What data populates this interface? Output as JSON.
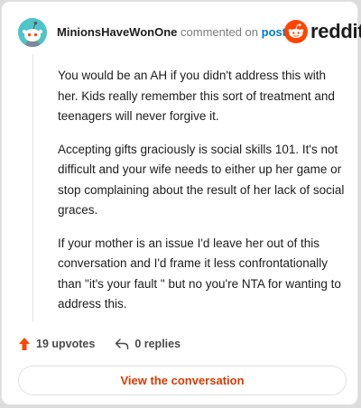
{
  "header": {
    "username": "MinionsHaveWonOne",
    "action_text": "commented on",
    "post_link": "post",
    "brand": "reddit"
  },
  "comment": {
    "paragraphs": [
      "You would be an AH if you didn't address this with her. Kids really remember this sort of treatment and teenagers will never forgive it.",
      "Accepting gifts graciously is social skills 101. It's not difficult and your wife needs to either up her game or stop complaining about the result of her lack of social graces.",
      "If your mother is an issue I'd leave her out of this conversation and I'd frame it less confrontationally than \"it's your fault \" but no you're NTA for wanting to address this."
    ]
  },
  "actions": {
    "upvotes": "19 upvotes",
    "replies": "0 replies"
  },
  "cta": {
    "label": "View the conversation"
  },
  "colors": {
    "brand_orange": "#ff4500",
    "cta_text": "#d93a00",
    "link_blue": "#0079d3",
    "avatar_bg": "#4fc4c9"
  },
  "icons": {
    "avatar": "snoo-avatar-icon",
    "logo": "reddit-logo-icon",
    "upvote": "upvote-arrow-icon",
    "reply": "reply-arrow-icon"
  }
}
